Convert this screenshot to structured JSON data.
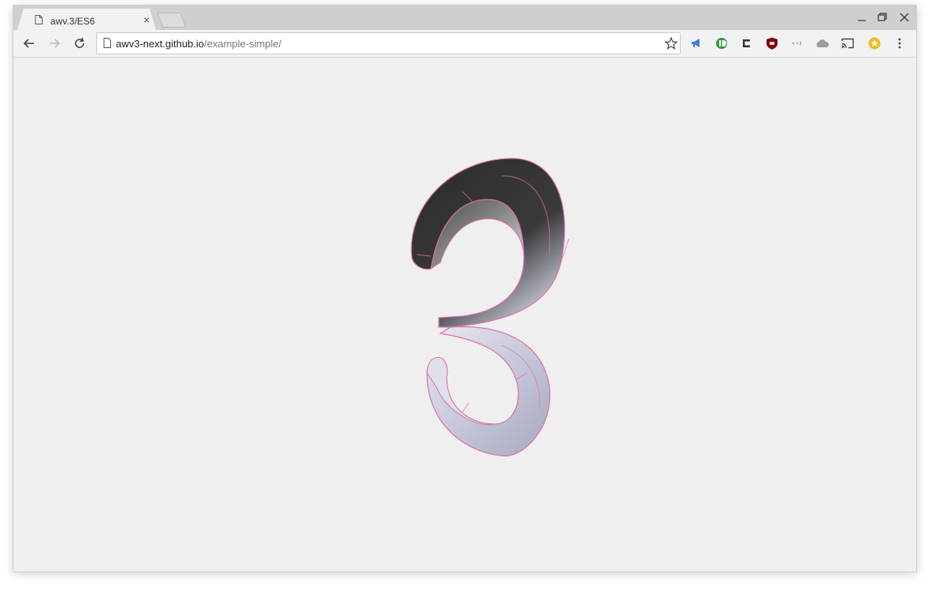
{
  "browser": {
    "tab": {
      "title": "awv.3/ES6",
      "close_label": "×",
      "icon": "page-icon"
    },
    "new_tab_icon": "new-tab-icon",
    "window_controls": [
      "minimize-icon",
      "restore-icon",
      "close-icon"
    ],
    "toolbar": {
      "back_icon": "back-arrow-icon",
      "forward_icon": "forward-arrow-icon",
      "reload_icon": "reload-icon",
      "url_host": "awv3-next.github.io",
      "url_path": "/example-simple/",
      "bookmark_icon": "star-icon",
      "extensions": [
        "megaphone-icon",
        "pushbullet-icon",
        "bracket-icon",
        "ublock-icon",
        "dots-icon",
        "cloud-icon",
        "cast-icon",
        "star-badge-icon",
        "kebab-menu-icon"
      ]
    }
  },
  "colors": {
    "tabstrip": "#cfcfcf",
    "toolbar": "#f2f2f2",
    "page_bg": "#efefef",
    "edge": "#e06fa8",
    "dark_surface": "#333333",
    "light_surface": "#b9bbd0"
  },
  "viewport": {
    "model": "3d-digit-3-model"
  }
}
